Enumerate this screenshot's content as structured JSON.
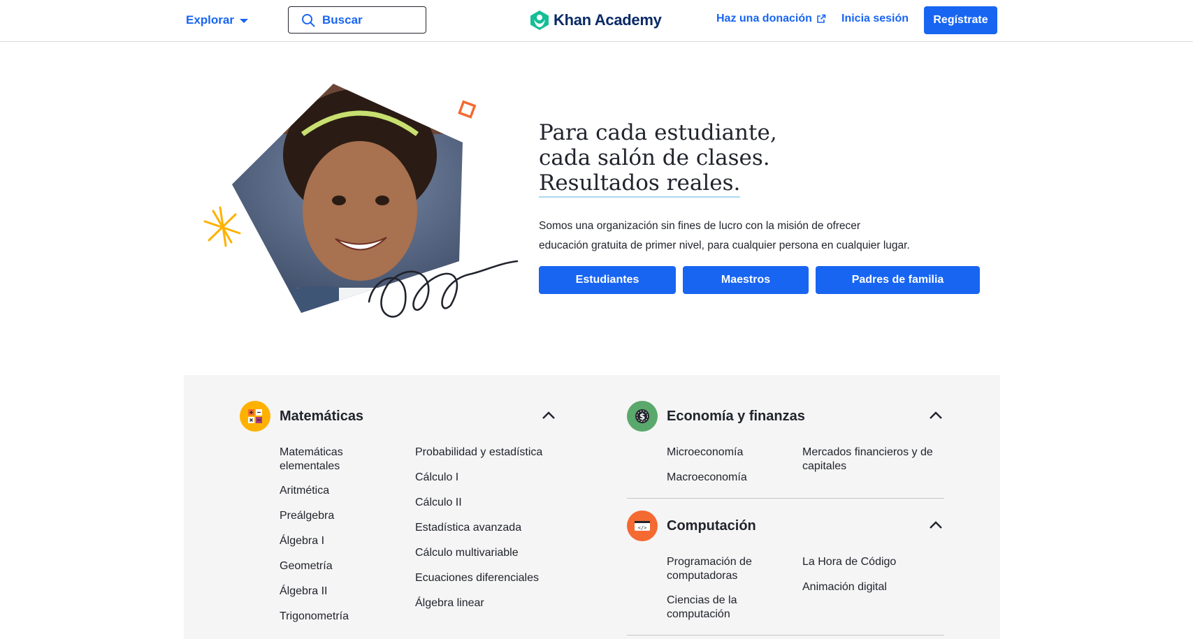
{
  "header": {
    "explore_label": "Explorar",
    "search_placeholder": "Buscar",
    "logo_text": "Khan Academy",
    "donate_label": "Haz una donación",
    "login_label": "Inicia sesión",
    "signup_label": "Regístrate"
  },
  "hero": {
    "title_lines": [
      "Para cada estudiante,",
      "cada salón de clases.",
      "Resultados reales."
    ],
    "description_lines": [
      "Somos una organización sin fines de lucro con la misión de ofrecer",
      "educación gratuita de primer nivel, para cualquier persona en cualquier lugar."
    ],
    "buttons": [
      "Estudiantes",
      "Maestros",
      "Padres de familia"
    ]
  },
  "subjects": {
    "math": {
      "title": "Matemáticas",
      "col1": [
        "Matemáticas elementales",
        "Aritmética",
        "Preálgebra",
        "Álgebra I",
        "Geometría",
        "Álgebra II",
        "Trigonometría"
      ],
      "col2": [
        "Probabilidad y estadística",
        "Cálculo I",
        "Cálculo II",
        "Estadística avanzada",
        "Cálculo multivariable",
        "Ecuaciones diferenciales",
        "Álgebra linear"
      ]
    },
    "econ": {
      "title": "Economía y finanzas",
      "col1": [
        "Microeconomía",
        "Macroeconomía"
      ],
      "col2": [
        "Mercados financieros y de capitales"
      ]
    },
    "comp": {
      "title": "Computación",
      "col1": [
        "Programación de computadoras",
        "Ciencias de la computación"
      ],
      "col2": [
        "La Hora de Código",
        "Animación digital"
      ]
    }
  },
  "colors": {
    "primary": "#1865f2",
    "math_icon": "#ffb100",
    "econ_icon": "#5aa86b",
    "comp_icon": "#f46a32"
  },
  "icons": [
    "chevron-down-icon",
    "search-icon",
    "khan-logo-icon",
    "external-link-icon",
    "chevron-up-icon"
  ]
}
